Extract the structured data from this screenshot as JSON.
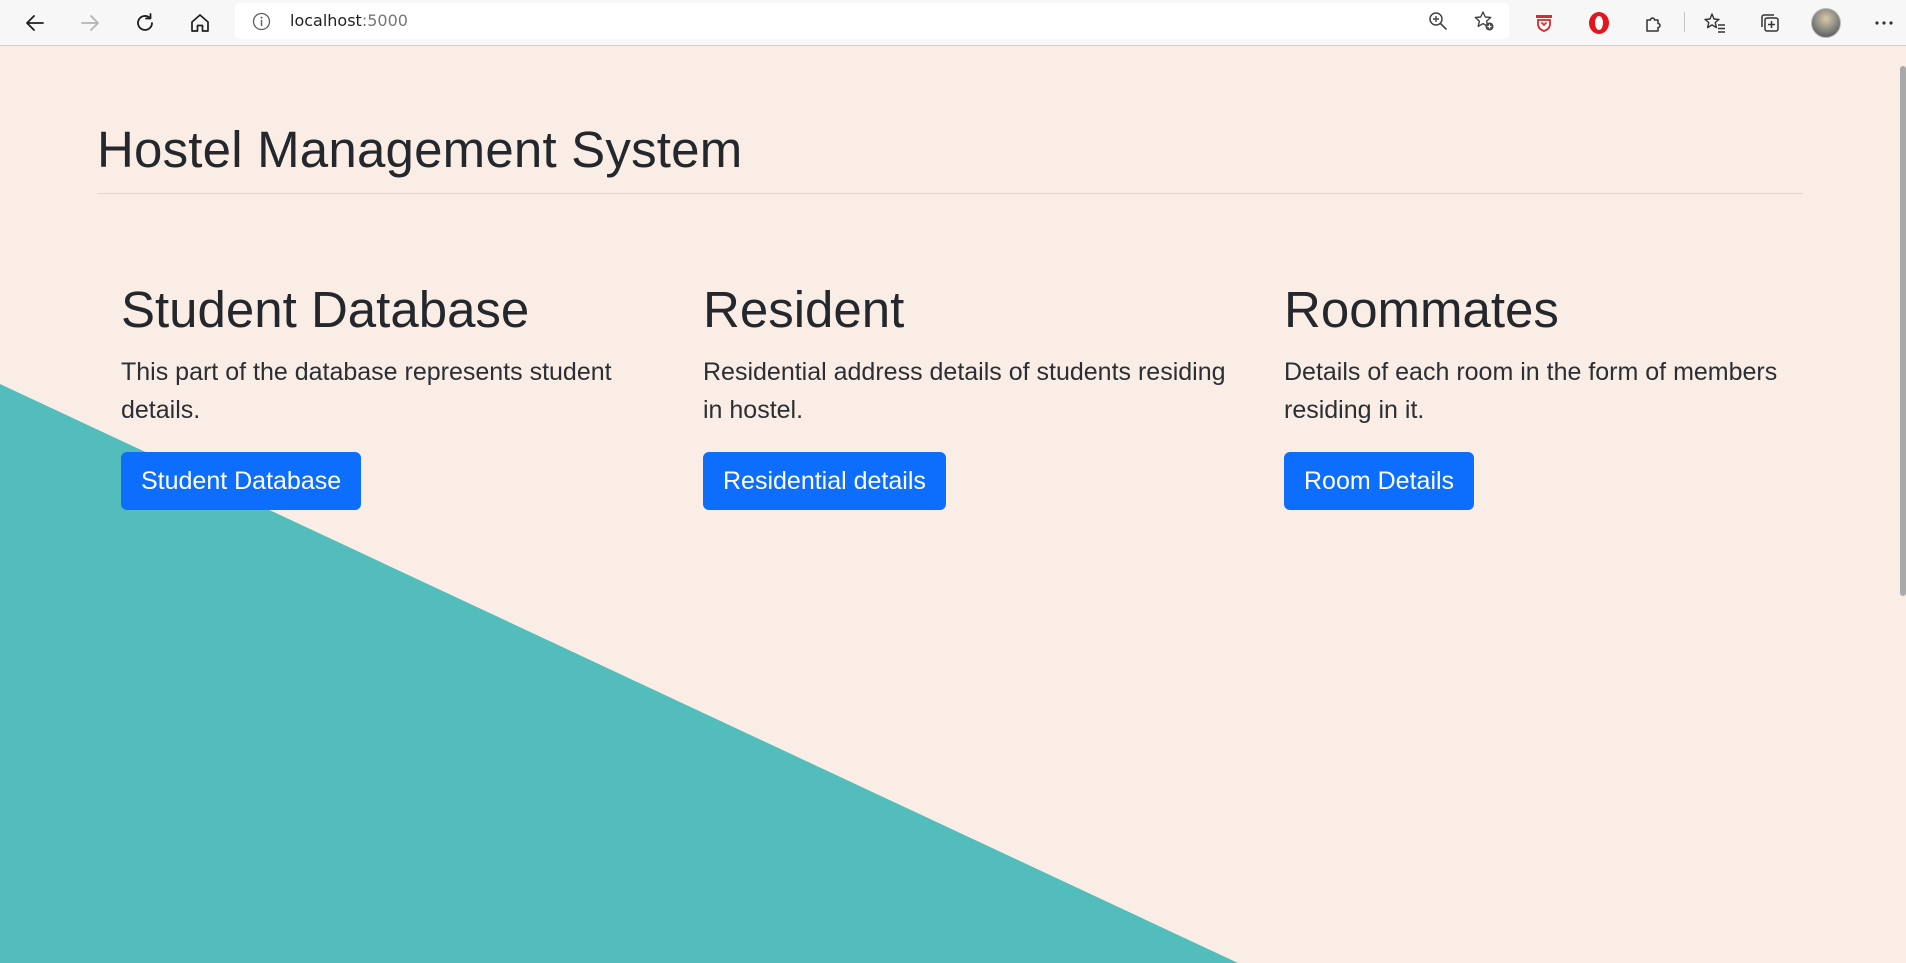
{
  "browser": {
    "url_host": "localhost",
    "url_port": ":5000"
  },
  "page": {
    "title": "Hostel Management System",
    "background_color": "#faede5",
    "accent_shape_color": "#52bdba",
    "button_color": "#0d6efd"
  },
  "cards": [
    {
      "heading": "Student Database",
      "description": "This part of the database represents student details.",
      "button_label": "Student Database"
    },
    {
      "heading": "Resident",
      "description": "Residential address details of students residing in hostel.",
      "button_label": "Residential details"
    },
    {
      "heading": "Roommates",
      "description": "Details of each room in the form of members residing in it.",
      "button_label": "Room Details"
    }
  ],
  "icons": {
    "back": "arrow-left-icon",
    "forward": "arrow-right-icon",
    "refresh": "refresh-icon",
    "home": "home-icon",
    "site_info": "info-icon",
    "zoom": "zoom-in-icon",
    "add_favorite": "star-add-icon",
    "extension_red": "shield-extension-icon",
    "extension_opera": "opera-extension-icon",
    "extensions": "puzzle-icon",
    "favorites": "favorites-icon",
    "collections": "collections-icon",
    "profile": "avatar",
    "menu": "more-icon"
  }
}
